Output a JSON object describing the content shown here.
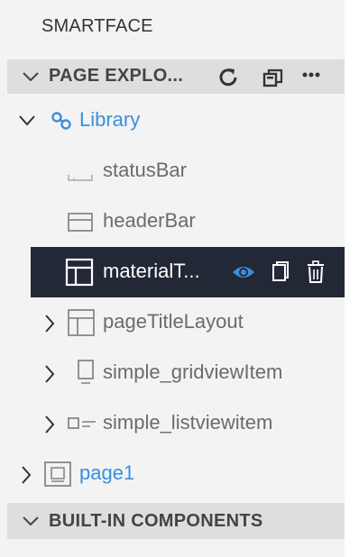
{
  "app_title": "SMARTFACE",
  "page_explorer": {
    "title": "PAGE EXPLO...",
    "refresh_icon": "refresh-icon",
    "collapse_icon": "collapse-all-icon",
    "more_icon": "more-icon"
  },
  "tree": {
    "library_label": "Library",
    "items": [
      {
        "label": "statusBar",
        "icon": "statusbar-icon"
      },
      {
        "label": "headerBar",
        "icon": "headerbar-icon"
      },
      {
        "label": "materialT...",
        "icon": "layout-icon",
        "selected": true
      },
      {
        "label": "pageTitleLayout",
        "icon": "layout-icon",
        "expandable": true
      },
      {
        "label": "simple_gridviewItem",
        "icon": "gridview-item-icon",
        "expandable": true
      },
      {
        "label": "simple_listviewitem",
        "icon": "listview-item-icon",
        "expandable": true
      }
    ],
    "page1_label": "page1"
  },
  "builtin": {
    "title": "BUILT-IN COMPONENTS"
  },
  "colors": {
    "accent": "#3b8fe0",
    "selected_bg": "#232837",
    "panel_bg": "#f3f3f3",
    "header_bg": "#dedede"
  }
}
